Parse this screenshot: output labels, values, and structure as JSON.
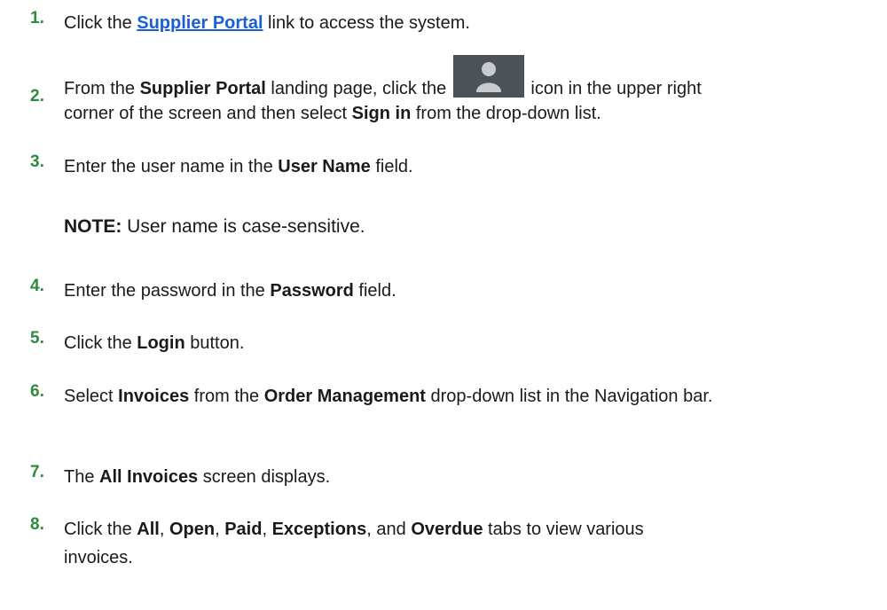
{
  "steps": [
    {
      "num": "1.",
      "parts": [
        "Click the ",
        "Supplier Portal",
        " link to access the system."
      ]
    },
    {
      "num": "2.",
      "parts": [
        "From the ",
        "Supplier Portal",
        " landing page, click the ",
        " icon in the upper right corner of the screen and then select ",
        "Sign in",
        " from the drop-down list."
      ]
    },
    {
      "num": "3.",
      "parts": [
        "Enter the user name in the ",
        "User Name",
        " field."
      ]
    },
    {
      "note_label": "NOTE:",
      "note_text": " User name is case-sensitive."
    },
    {
      "num": "4.",
      "parts": [
        "Enter the password in the ",
        "Password",
        " field."
      ]
    },
    {
      "num": "5.",
      "parts": [
        "Click the ",
        "Login",
        " button."
      ]
    },
    {
      "num": "6.",
      "parts": [
        "Select ",
        "Invoices",
        " from the ",
        "Order Management",
        " drop-down list in the Navigation bar."
      ]
    },
    {
      "num": "7.",
      "parts": [
        "The ",
        "All Invoices",
        " screen displays."
      ]
    },
    {
      "num": "8.",
      "parts": [
        "Click the ",
        "All",
        ", ",
        "Open",
        ", ",
        "Paid",
        ", ",
        "Exceptions",
        ", and ",
        "Overdue",
        " tabs to view various invoices."
      ]
    }
  ],
  "icons": {
    "user_icon": "user-avatar-icon"
  },
  "colors": {
    "step_number": "#2e8b3d",
    "link": "#1a5fd6",
    "avatar_bg": "#4b5258"
  }
}
